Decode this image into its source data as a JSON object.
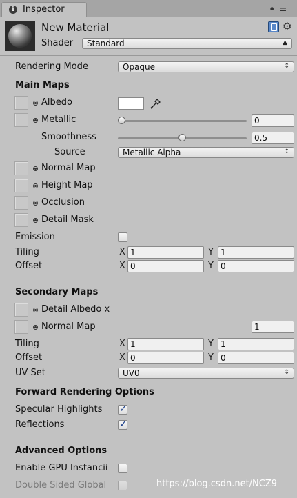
{
  "tab": {
    "label": "Inspector"
  },
  "header": {
    "material_name": "New Material",
    "shader_label": "Shader",
    "shader_value": "Standard"
  },
  "rendering_mode": {
    "label": "Rendering Mode",
    "value": "Opaque"
  },
  "main_maps": {
    "heading": "Main Maps",
    "albedo_label": "Albedo",
    "albedo_color": "#ffffff",
    "metallic_label": "Metallic",
    "metallic_value": "0",
    "metallic_level": 0,
    "smoothness_label": "Smoothness",
    "smoothness_value": "0.5",
    "smoothness_level": 0.5,
    "source_label": "Source",
    "source_value": "Metallic Alpha",
    "normal_map_label": "Normal Map",
    "height_map_label": "Height Map",
    "occlusion_label": "Occlusion",
    "detail_mask_label": "Detail Mask",
    "emission_label": "Emission",
    "emission_checked": false,
    "tiling_label": "Tiling",
    "tiling_x": "1",
    "tiling_y": "1",
    "offset_label": "Offset",
    "offset_x": "0",
    "offset_y": "0"
  },
  "secondary_maps": {
    "heading": "Secondary Maps",
    "detail_albedo_label": "Detail Albedo x",
    "normal_map_label": "Normal Map",
    "normal_map_value": "1",
    "tiling_label": "Tiling",
    "tiling_x": "1",
    "tiling_y": "1",
    "offset_label": "Offset",
    "offset_x": "0",
    "offset_y": "0",
    "uv_set_label": "UV Set",
    "uv_set_value": "UV0"
  },
  "forward_rendering": {
    "heading": "Forward Rendering Options",
    "specular_label": "Specular Highlights",
    "specular_checked": true,
    "reflections_label": "Reflections",
    "reflections_checked": true
  },
  "advanced": {
    "heading": "Advanced Options",
    "gpu_instancing_label": "Enable GPU Instancii",
    "gpu_instancing_checked": false,
    "double_sided_label": "Double Sided Global",
    "double_sided_checked": false
  },
  "axis": {
    "x": "X",
    "y": "Y"
  },
  "watermark": "https://blog.csdn.net/NCZ9_",
  "icons": {
    "info": "info-icon",
    "lock": "lock-icon",
    "menu": "menu-icon",
    "help": "help-book-icon",
    "settings": "gear-icon",
    "picker": "eyedropper-icon",
    "target": "object-picker-icon",
    "dropdown": "dropdown-arrow-icon"
  },
  "colors": {
    "panel": "#c2c2c2",
    "tab_bar": "#a5a5a5",
    "check": "#1b3f8a"
  }
}
